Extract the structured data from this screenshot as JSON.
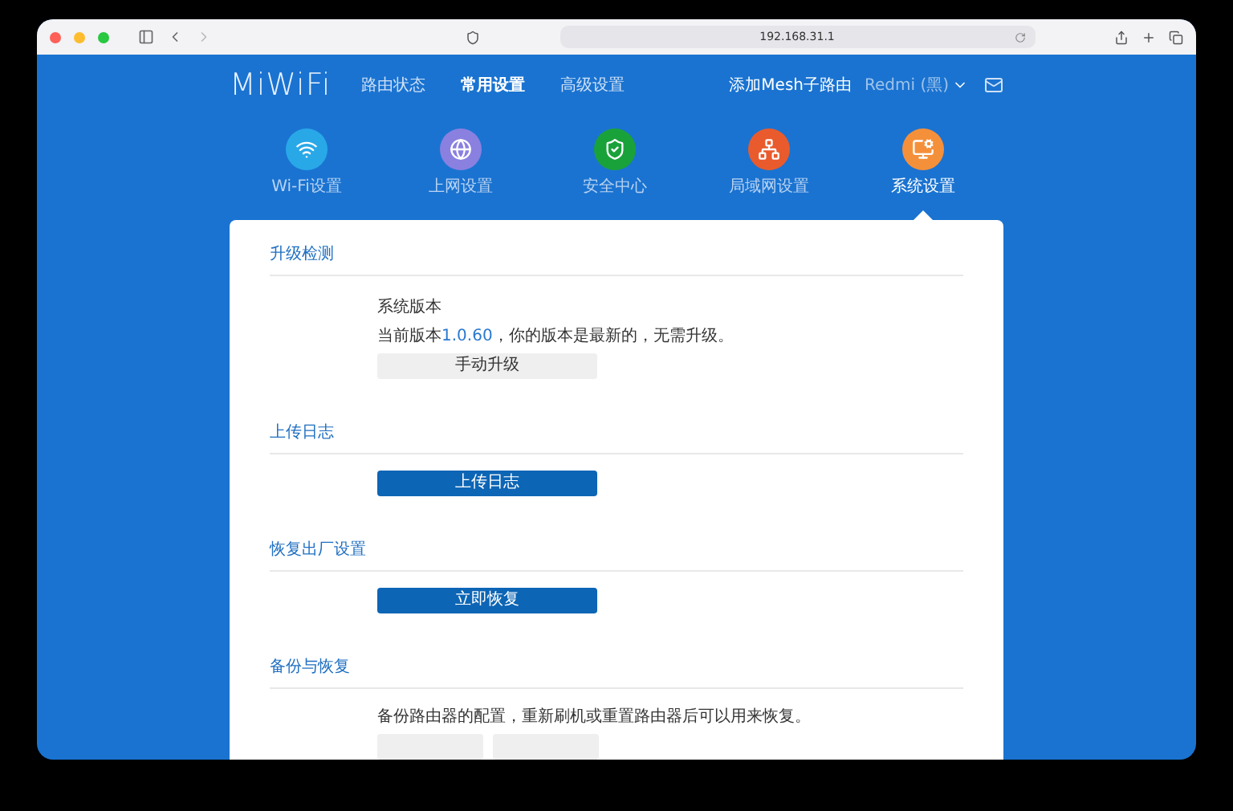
{
  "browser": {
    "url": "192.168.31.1"
  },
  "header": {
    "logo": "MiWiFi",
    "nav": [
      {
        "label": "路由状态",
        "selected": false
      },
      {
        "label": "常用设置",
        "selected": true
      },
      {
        "label": "高级设置",
        "selected": false
      }
    ],
    "mesh_link": "添加Mesh子路由",
    "device": "Redmi (黑)"
  },
  "categories": [
    {
      "label": "Wi-Fi设置",
      "color": "#29a8e8",
      "selected": false
    },
    {
      "label": "上网设置",
      "color": "#8a80e0",
      "selected": false
    },
    {
      "label": "安全中心",
      "color": "#1aa23a",
      "selected": false
    },
    {
      "label": "局域网设置",
      "color": "#e95b2c",
      "selected": false
    },
    {
      "label": "系统设置",
      "color": "#f5903a",
      "selected": true
    }
  ],
  "sections": [
    {
      "kind": "version",
      "title": "升级检测",
      "subtitle": "系统版本",
      "text_before": "当前版本",
      "version": "1.0.60",
      "text_after": "，你的版本是最新的，无需升级。",
      "button": {
        "label": "手动升级",
        "kind": "secondary"
      }
    },
    {
      "kind": "action",
      "title": "上传日志",
      "button": {
        "label": "上传日志",
        "kind": "primary"
      }
    },
    {
      "kind": "action",
      "title": "恢复出厂设置",
      "button": {
        "label": "立即恢复",
        "kind": "primary"
      }
    },
    {
      "kind": "backup",
      "title": "备份与恢复",
      "text": "备份路由器的配置，重新刷机或重置路由器后可以用来恢复。"
    }
  ]
}
